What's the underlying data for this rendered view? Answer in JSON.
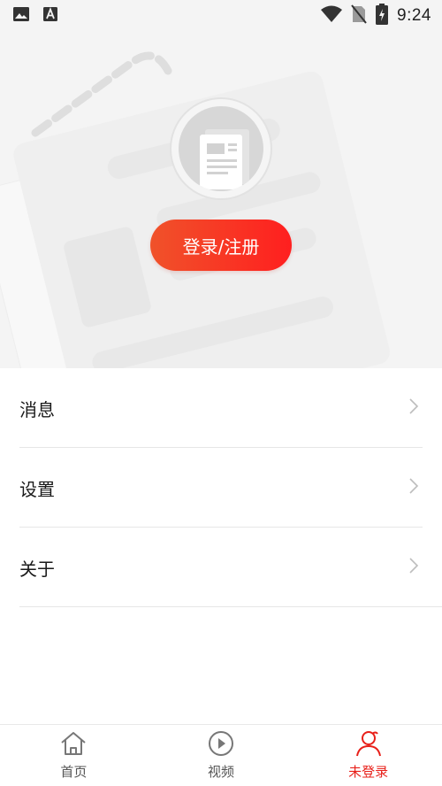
{
  "status_bar": {
    "time": "9:24",
    "icons": [
      "image-icon",
      "a-letter-icon",
      "wifi-icon",
      "no-sim-icon",
      "battery-charging-icon"
    ]
  },
  "header": {
    "login_label": "登录/注册",
    "avatar_icon": "newspaper-icon"
  },
  "menu": {
    "items": [
      {
        "label": "消息"
      },
      {
        "label": "设置"
      },
      {
        "label": "关于"
      }
    ]
  },
  "bottom_nav": {
    "items": [
      {
        "label": "首页",
        "icon": "home-icon",
        "active": false
      },
      {
        "label": "视频",
        "icon": "play-circle-icon",
        "active": false
      },
      {
        "label": "未登录",
        "icon": "user-icon",
        "active": true
      }
    ]
  },
  "colors": {
    "accent": "#e8201a",
    "button_gradient_start": "#f0522a",
    "button_gradient_end": "#ff1f1f",
    "header_bg": "#f4f4f4"
  }
}
